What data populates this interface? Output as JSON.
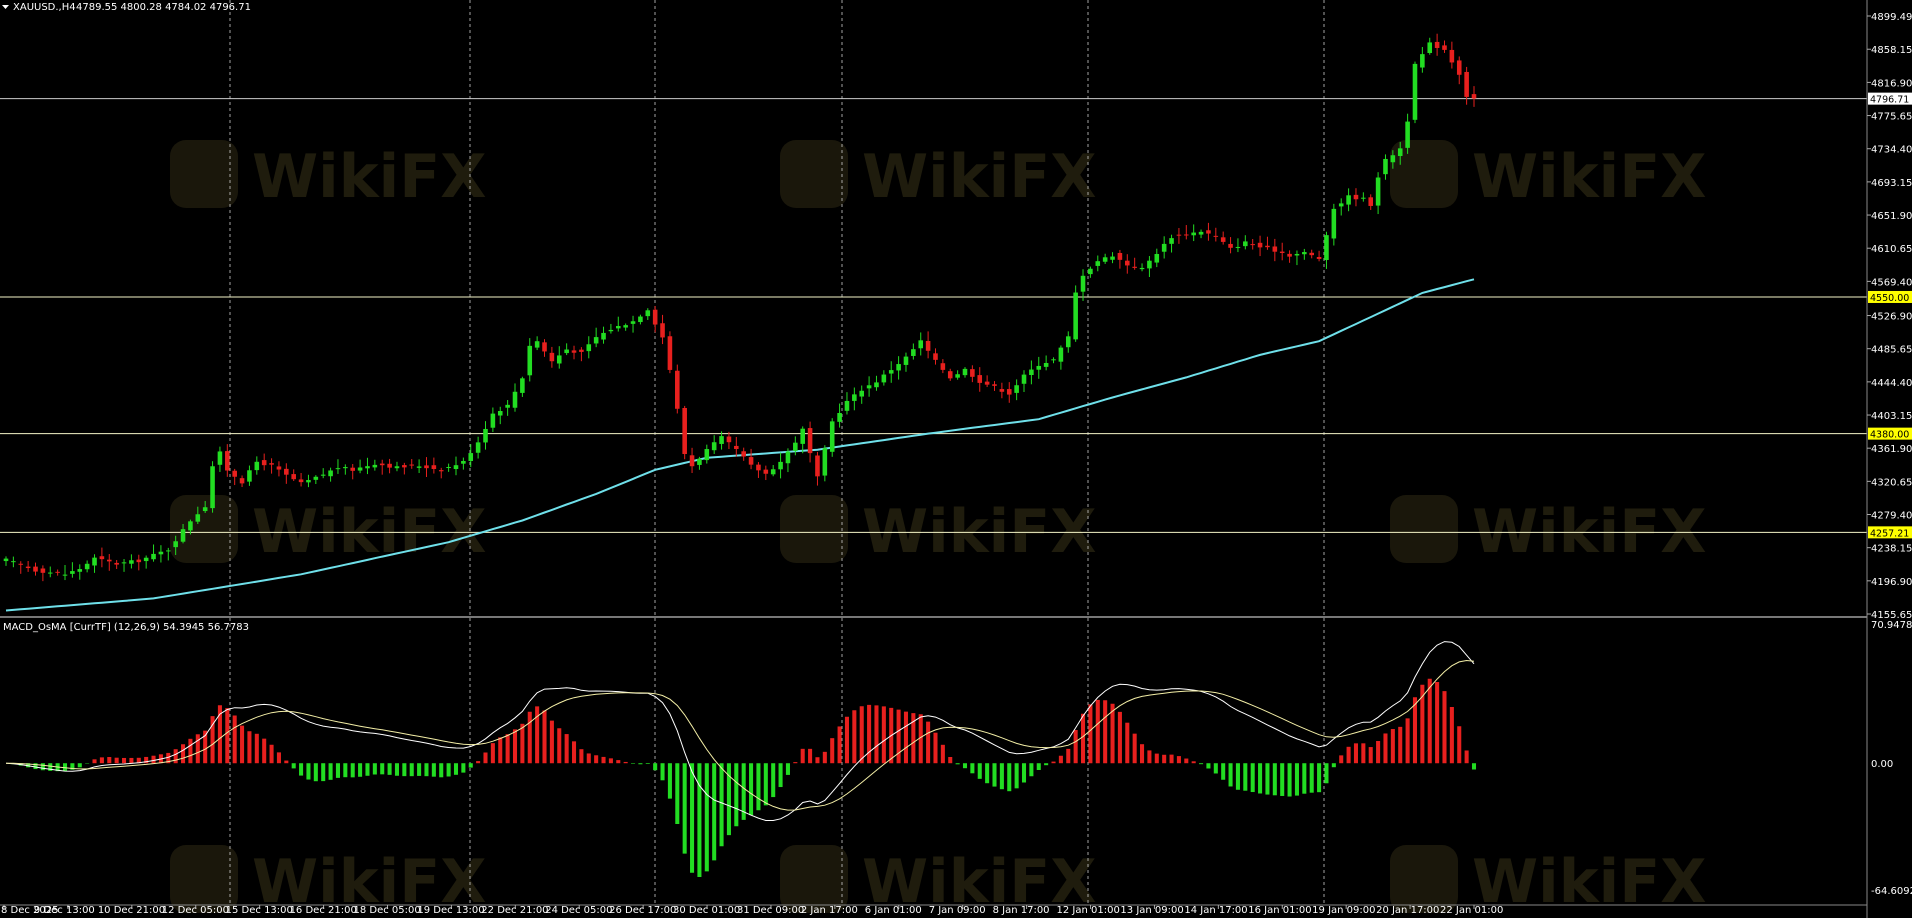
{
  "header": {
    "symbol": "XAUUSD.,H4",
    "ohlc": "4789.55 4800.28 4784.02 4796.71"
  },
  "indicator": {
    "label": "MACD_OsMA [CurrTF] (12,26,9) 54.3945 56.7783"
  },
  "watermark": "WikiFX",
  "colors": {
    "background": "#000000",
    "bull": "#22dd22",
    "bear": "#e8201e",
    "ma": "#6fe0ea",
    "grid": "#d8d8d8",
    "hline": "#f5f5c8",
    "level_label_bg": "#ffff00",
    "current_label_bg": "#ffffff",
    "axis_text": "#ffffff",
    "macd_fast": "#ffffff",
    "macd_slow": "#f3eea6"
  },
  "chart_data": [
    {
      "type": "candlestick",
      "timeframe": "H4",
      "ylim": [
        4155.65,
        4899.49
      ],
      "y_ticks": [
        "4899.49",
        "4858.15",
        "4816.90",
        "4775.65",
        "4734.40",
        "4693.15",
        "4651.90",
        "4610.65",
        "4569.40",
        "4526.90",
        "4485.65",
        "4444.40",
        "4403.15",
        "4361.90",
        "4320.65",
        "4279.40",
        "4238.15",
        "4196.90",
        "4155.65"
      ],
      "x_ticks": [
        "8 Dec 2025",
        "9 Dec 13:00",
        "10 Dec 21:00",
        "12 Dec 05:00",
        "15 Dec 13:00",
        "16 Dec 21:00",
        "18 Dec 05:00",
        "19 Dec 13:00",
        "22 Dec 21:00",
        "24 Dec 05:00",
        "26 Dec 17:00",
        "30 Dec 01:00",
        "31 Dec 09:00",
        "2 Jan 17:00",
        "6 Jan 01:00",
        "7 Jan 09:00",
        "8 Jan 17:00",
        "12 Jan 01:00",
        "13 Jan 09:00",
        "14 Jan 17:00",
        "16 Jan 01:00",
        "19 Jan 09:00",
        "20 Jan 17:00",
        "22 Jan 01:00"
      ],
      "horizontal_levels": [
        {
          "value": 4550.0,
          "label": "4550.00",
          "style": "level"
        },
        {
          "value": 4380.0,
          "label": "4380.00",
          "style": "level"
        },
        {
          "value": 4257.21,
          "label": "4257.21",
          "style": "level"
        },
        {
          "value": 4796.71,
          "label": "4796.71",
          "style": "current"
        }
      ],
      "anchors_close": [
        [
          0,
          4223
        ],
        [
          4,
          4210
        ],
        [
          8,
          4205
        ],
        [
          10,
          4212
        ],
        [
          12,
          4225
        ],
        [
          15,
          4218
        ],
        [
          18,
          4222
        ],
        [
          22,
          4236
        ],
        [
          25,
          4272
        ],
        [
          27,
          4290
        ],
        [
          28,
          4340
        ],
        [
          29,
          4356
        ],
        [
          30,
          4335
        ],
        [
          32,
          4320
        ],
        [
          34,
          4345
        ],
        [
          36,
          4340
        ],
        [
          38,
          4328
        ],
        [
          40,
          4318
        ],
        [
          42,
          4325
        ],
        [
          45,
          4338
        ],
        [
          47,
          4335
        ],
        [
          50,
          4343
        ],
        [
          53,
          4338
        ],
        [
          56,
          4340
        ],
        [
          59,
          4335
        ],
        [
          62,
          4345
        ],
        [
          64,
          4370
        ],
        [
          66,
          4405
        ],
        [
          68,
          4415
        ],
        [
          70,
          4450
        ],
        [
          71,
          4490
        ],
        [
          72,
          4495
        ],
        [
          74,
          4470
        ],
        [
          76,
          4485
        ],
        [
          78,
          4480
        ],
        [
          80,
          4500
        ],
        [
          82,
          4510
        ],
        [
          85,
          4520
        ],
        [
          87,
          4535
        ],
        [
          89,
          4500
        ],
        [
          90,
          4460
        ],
        [
          91,
          4410
        ],
        [
          92,
          4355
        ],
        [
          93,
          4340
        ],
        [
          95,
          4360
        ],
        [
          97,
          4375
        ],
        [
          99,
          4360
        ],
        [
          101,
          4340
        ],
        [
          103,
          4330
        ],
        [
          105,
          4345
        ],
        [
          107,
          4370
        ],
        [
          108,
          4385
        ],
        [
          110,
          4325
        ],
        [
          112,
          4395
        ],
        [
          114,
          4420
        ],
        [
          116,
          4435
        ],
        [
          118,
          4445
        ],
        [
          120,
          4460
        ],
        [
          122,
          4475
        ],
        [
          124,
          4495
        ],
        [
          126,
          4470
        ],
        [
          128,
          4450
        ],
        [
          130,
          4460
        ],
        [
          132,
          4445
        ],
        [
          134,
          4438
        ],
        [
          136,
          4430
        ],
        [
          138,
          4452
        ],
        [
          140,
          4466
        ],
        [
          142,
          4472
        ],
        [
          144,
          4500
        ],
        [
          145,
          4555
        ],
        [
          146,
          4578
        ],
        [
          148,
          4595
        ],
        [
          150,
          4602
        ],
        [
          152,
          4590
        ],
        [
          154,
          4585
        ],
        [
          156,
          4605
        ],
        [
          158,
          4625
        ],
        [
          160,
          4628
        ],
        [
          162,
          4632
        ],
        [
          164,
          4625
        ],
        [
          166,
          4610
        ],
        [
          168,
          4618
        ],
        [
          170,
          4612
        ],
        [
          172,
          4608
        ],
        [
          174,
          4602
        ],
        [
          176,
          4605
        ],
        [
          178,
          4598
        ],
        [
          179,
          4625
        ],
        [
          180,
          4660
        ],
        [
          182,
          4675
        ],
        [
          184,
          4672
        ],
        [
          185,
          4665
        ],
        [
          186,
          4700
        ],
        [
          187,
          4720
        ],
        [
          189,
          4735
        ],
        [
          190,
          4770
        ],
        [
          191,
          4838
        ],
        [
          193,
          4865
        ],
        [
          195,
          4858
        ],
        [
          197,
          4828
        ],
        [
          198,
          4800
        ],
        [
          199,
          4796.71
        ]
      ],
      "ma_anchors": [
        [
          0,
          4160
        ],
        [
          20,
          4175
        ],
        [
          40,
          4205
        ],
        [
          60,
          4245
        ],
        [
          70,
          4272
        ],
        [
          80,
          4305
        ],
        [
          88,
          4335
        ],
        [
          95,
          4350
        ],
        [
          110,
          4360
        ],
        [
          125,
          4380
        ],
        [
          140,
          4398
        ],
        [
          150,
          4425
        ],
        [
          160,
          4450
        ],
        [
          170,
          4478
        ],
        [
          178,
          4495
        ],
        [
          185,
          4525
        ],
        [
          192,
          4555
        ],
        [
          199,
          4572
        ]
      ]
    },
    {
      "type": "bar",
      "name": "MACD_OsMA [CurrTF] (12,26,9)",
      "ylim": [
        -64.6092,
        70.9478
      ],
      "y_ticks": [
        "70.9478",
        "0.00",
        "-64.6092"
      ],
      "values_current": [
        54.3945,
        56.7783
      ]
    }
  ]
}
